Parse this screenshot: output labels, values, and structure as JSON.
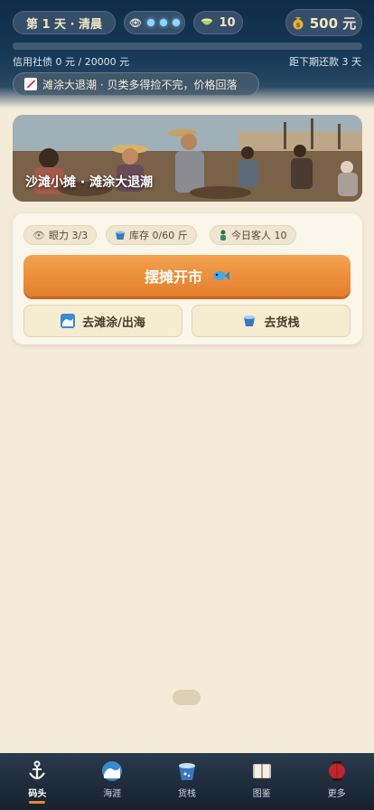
{
  "header": {
    "day_label": "第 1 天 · 清晨",
    "eye_dots": 3,
    "bowl_count": "10",
    "money": "500 元",
    "debt_progress": 0,
    "debt_text": "信用社债 0 元 / 20000 元",
    "due_text": "距下期还款 3 天",
    "event_text": "滩涂大退潮 · 贝类多得捡不完，价格回落"
  },
  "banner": {
    "title": "沙滩小摊 · 滩涂大退潮"
  },
  "stats": {
    "eyesight": "眼力 3/3",
    "stock": "库存 0/60 斤",
    "guests": "今日客人 10"
  },
  "actions": {
    "open_stall": "摆摊开市",
    "go_sea": "去滩涂/出海",
    "go_shop": "去货栈"
  },
  "tabs": [
    {
      "label": "码头",
      "icon": "anchor-icon",
      "active": true
    },
    {
      "label": "海涯",
      "icon": "wave-icon",
      "active": false
    },
    {
      "label": "货栈",
      "icon": "bucket-icon",
      "active": false
    },
    {
      "label": "图鉴",
      "icon": "book-icon",
      "active": false
    },
    {
      "label": "更多",
      "icon": "lantern-icon",
      "active": false
    }
  ],
  "colors": {
    "accent": "#e57e2a",
    "header": "#0e2c47",
    "page_bg": "#f4ecd9"
  }
}
